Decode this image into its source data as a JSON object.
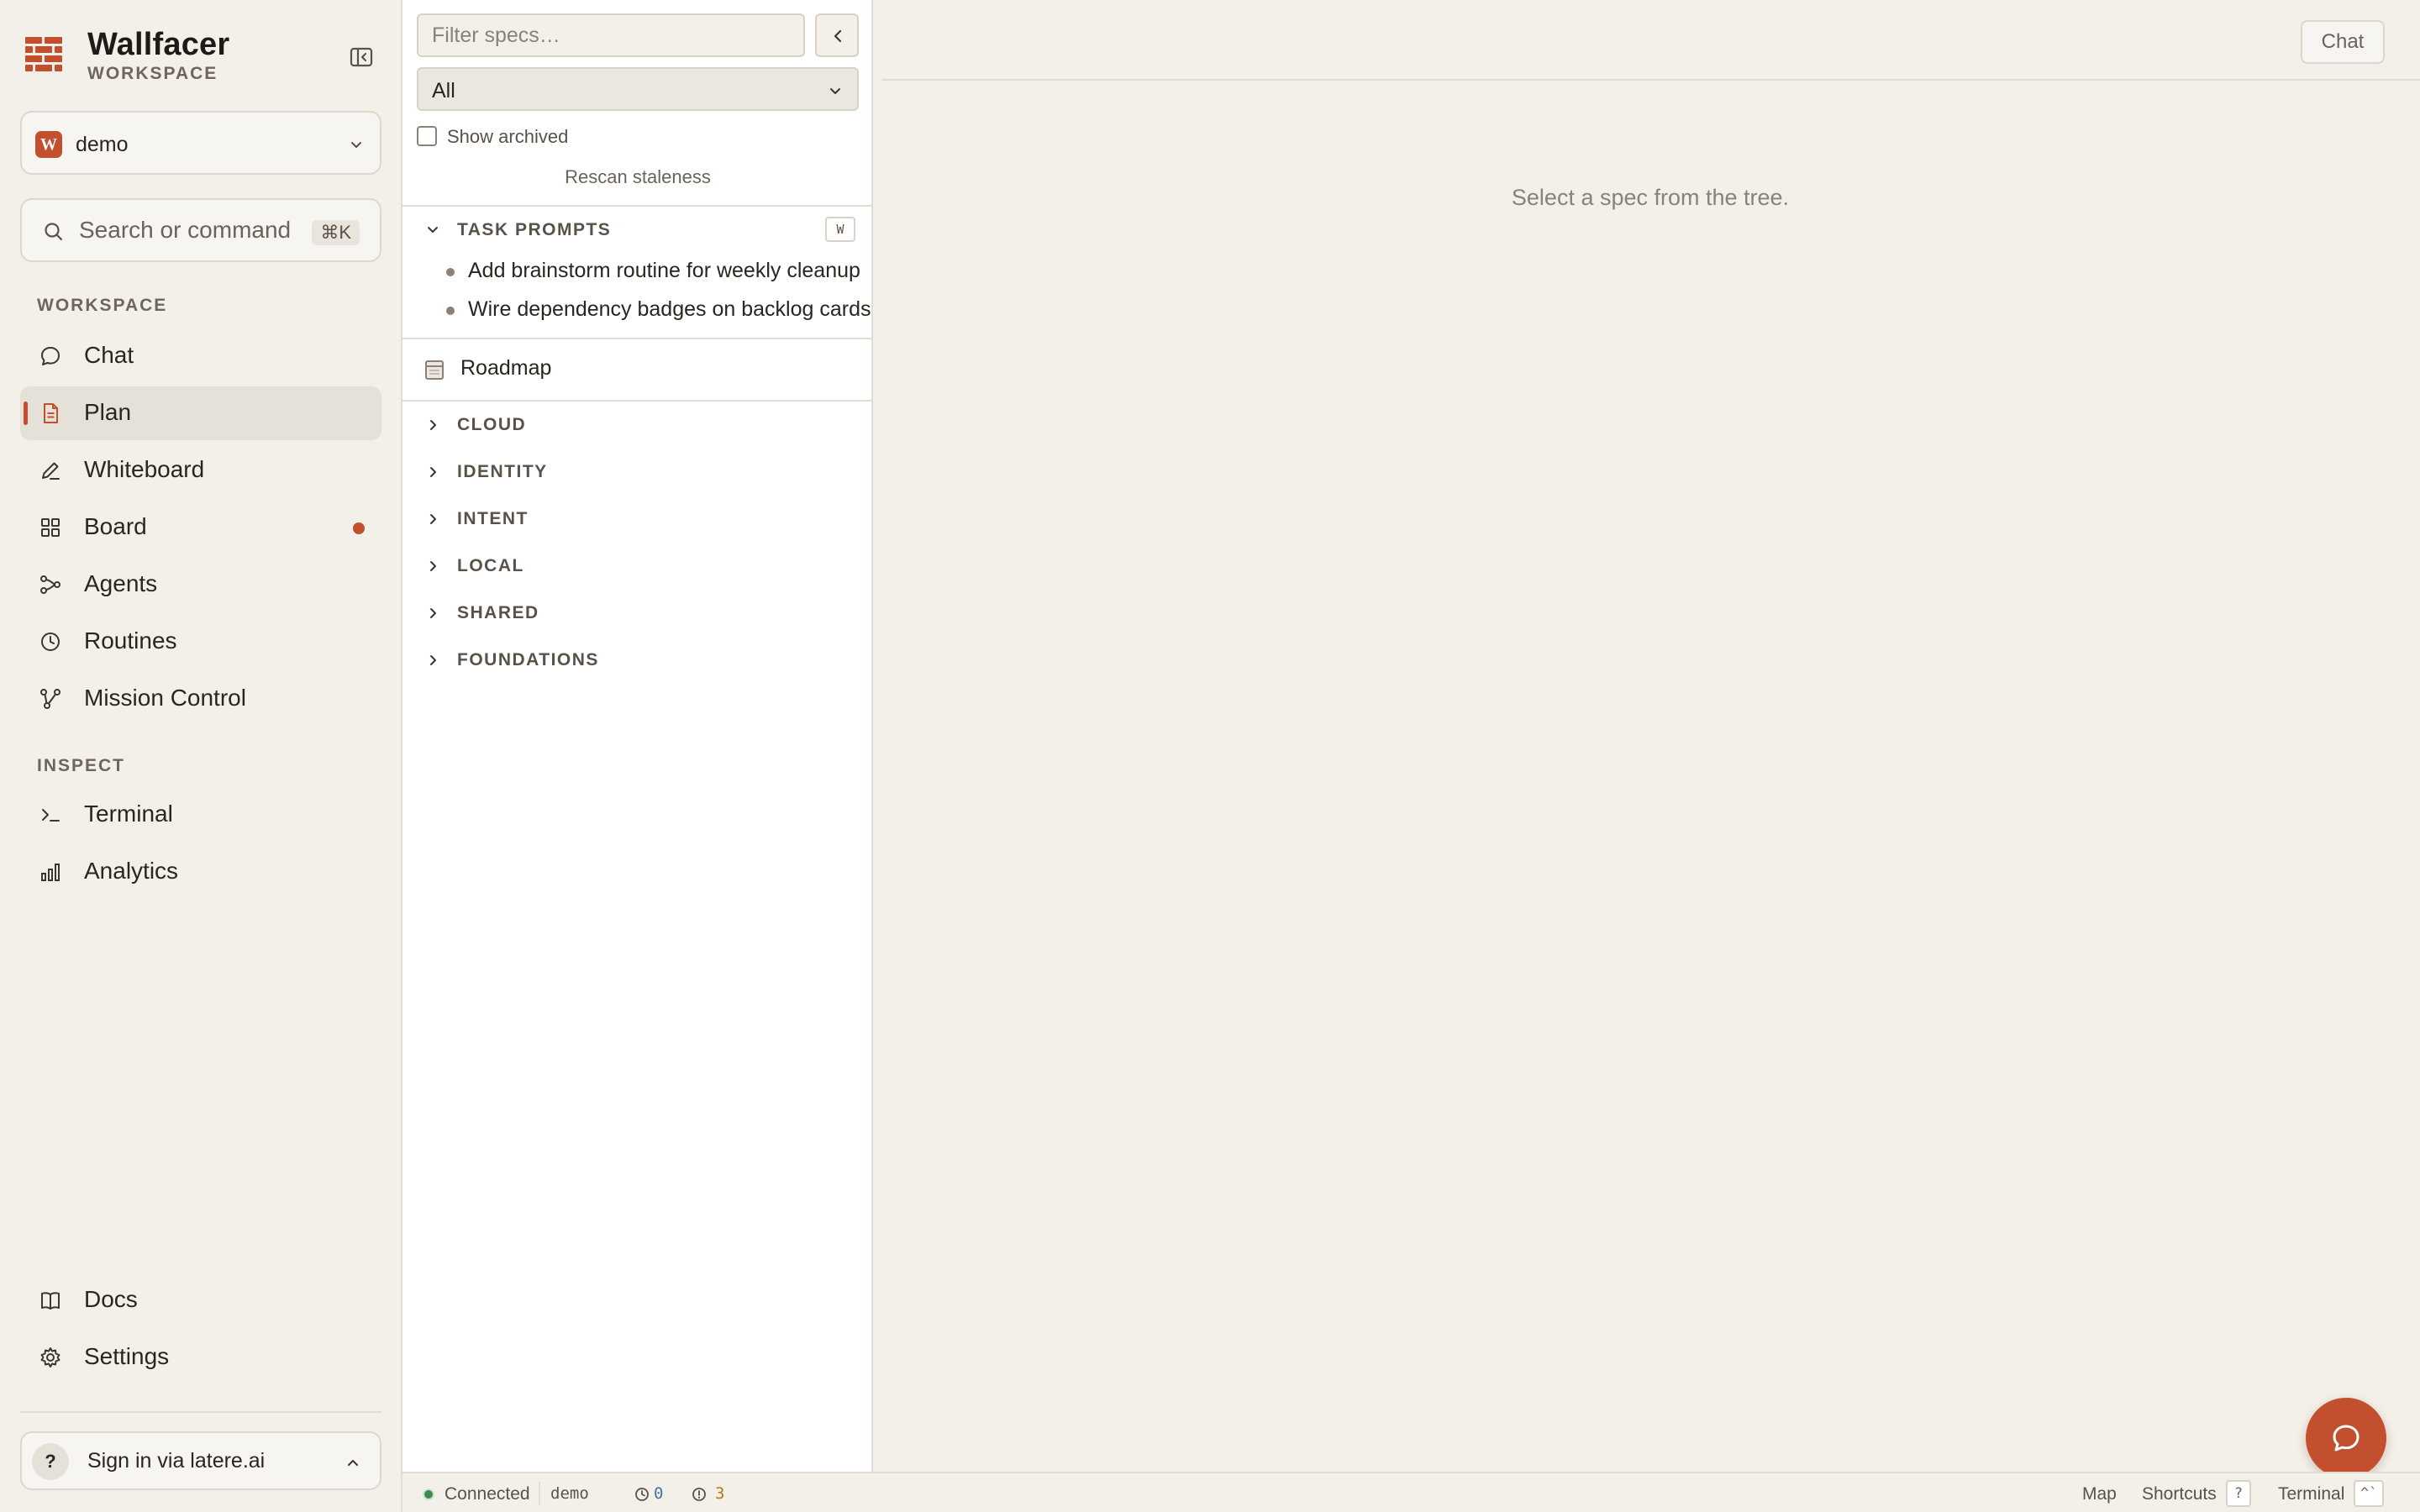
{
  "brand": {
    "title": "Wallfacer",
    "subtitle": "WORKSPACE"
  },
  "workspace_select": {
    "badge": "W",
    "name": "demo"
  },
  "search": {
    "placeholder": "Search or command",
    "shortcut": "⌘K"
  },
  "sidebar": {
    "workspace_label": "WORKSPACE",
    "workspace_items": [
      {
        "label": "Chat",
        "icon": "chat-bubble-icon"
      },
      {
        "label": "Plan",
        "icon": "document-icon",
        "active": true
      },
      {
        "label": "Whiteboard",
        "icon": "pencil-icon"
      },
      {
        "label": "Board",
        "icon": "grid-board-icon",
        "notification": true
      },
      {
        "label": "Agents",
        "icon": "agents-network-icon"
      },
      {
        "label": "Routines",
        "icon": "clock-icon"
      },
      {
        "label": "Mission Control",
        "icon": "mission-control-icon"
      }
    ],
    "inspect_label": "INSPECT",
    "inspect_items": [
      {
        "label": "Terminal",
        "icon": "terminal-icon"
      },
      {
        "label": "Analytics",
        "icon": "bar-chart-icon"
      }
    ],
    "bottom_items": [
      {
        "label": "Docs",
        "icon": "book-icon"
      },
      {
        "label": "Settings",
        "icon": "gear-icon"
      }
    ],
    "signin": {
      "icon_text": "?",
      "label": "Sign in via latere.ai"
    }
  },
  "spec_panel": {
    "filter_placeholder": "Filter specs…",
    "status_filter": "All",
    "show_archived_label": "Show archived",
    "show_archived": false,
    "rescan_label": "Rescan staleness",
    "task_prompts": {
      "label": "TASK PROMPTS",
      "shortcut": "W",
      "items": [
        "Add brainstorm routine for weekly cleanup",
        "Wire dependency badges on backlog cards"
      ]
    },
    "roadmap_label": "Roadmap",
    "groups": [
      "CLOUD",
      "IDENTITY",
      "INTENT",
      "LOCAL",
      "SHARED",
      "FOUNDATIONS"
    ]
  },
  "main": {
    "chat_button": "Chat",
    "empty_message": "Select a spec from the tree."
  },
  "statusbar": {
    "connection": "Connected",
    "workspace": "demo",
    "clock_count": "0",
    "warning_count": "3",
    "map_label": "Map",
    "shortcuts_label": "Shortcuts",
    "shortcuts_key": "?",
    "terminal_label": "Terminal",
    "terminal_key": "^`"
  },
  "colors": {
    "accent": "#c2502e",
    "background": "#f3f0ea",
    "panel": "#ffffff",
    "connected": "#3d8a4e",
    "clock_count": "#4a6fa5",
    "warning_count": "#b07a18"
  }
}
